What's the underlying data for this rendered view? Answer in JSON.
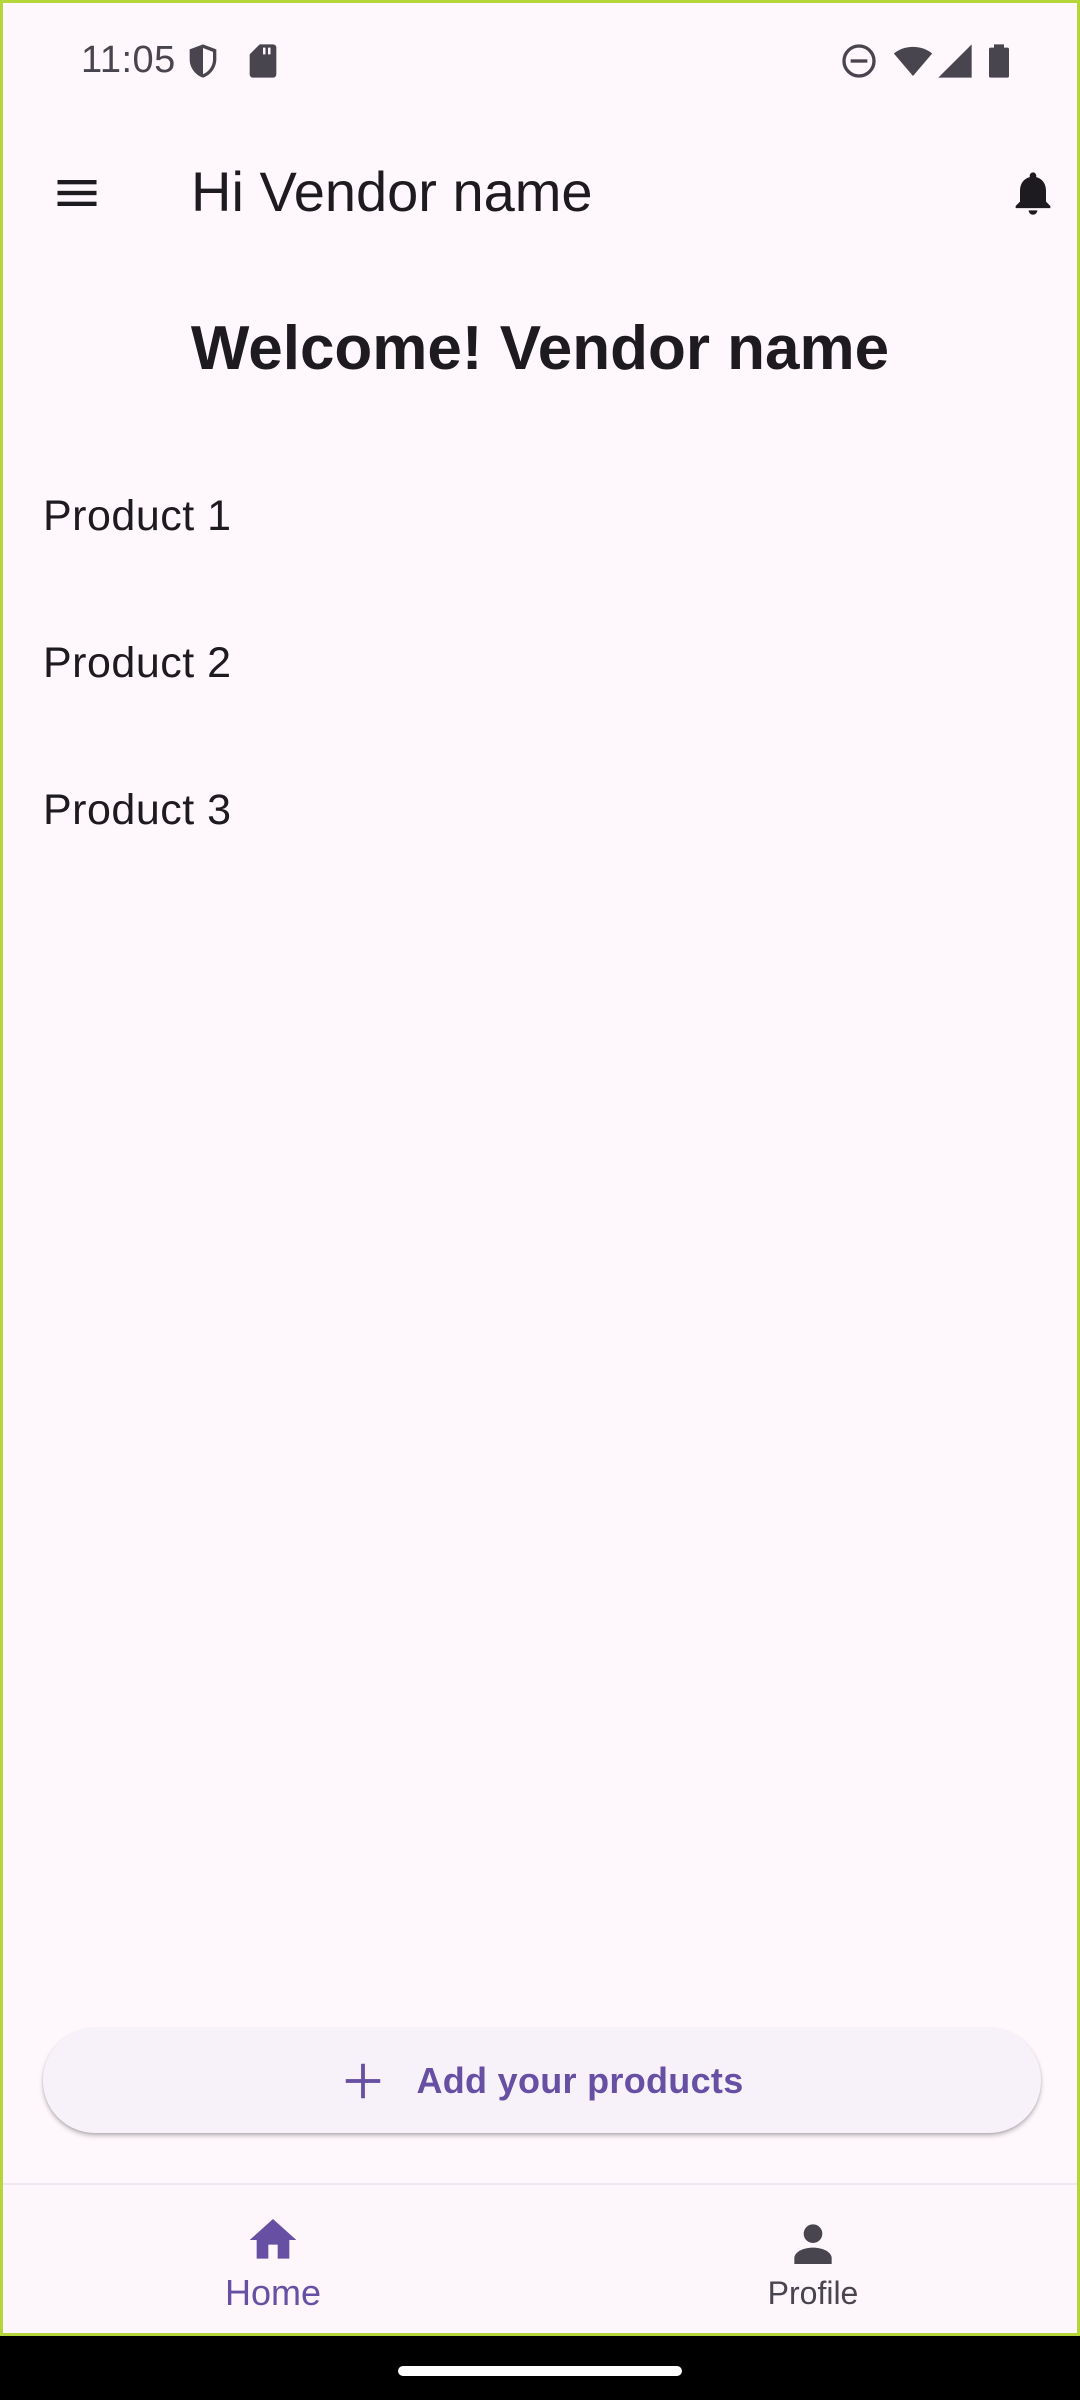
{
  "status_bar": {
    "time": "11:05",
    "icons": [
      "shield-icon",
      "sd-card-icon",
      "do-not-disturb-icon",
      "wifi-icon",
      "signal-icon",
      "battery-icon"
    ]
  },
  "app_bar": {
    "title": "Hi Vendor name",
    "menu_icon": "menu-icon",
    "notification_icon": "bell-icon"
  },
  "main": {
    "welcome": "Welcome! Vendor name",
    "products": [
      "Product 1",
      "Product 2",
      "Product 3"
    ]
  },
  "add_button": {
    "label": "Add your products",
    "icon": "plus-icon"
  },
  "bottom_nav": {
    "items": [
      {
        "label": "Home",
        "icon": "home-icon",
        "selected": true
      },
      {
        "label": "Profile",
        "icon": "person-icon",
        "selected": false
      }
    ]
  },
  "colors": {
    "background": "#fef7fc",
    "accent": "#6750a4",
    "text": "#1d1b20",
    "secondary_text": "#49454f"
  }
}
